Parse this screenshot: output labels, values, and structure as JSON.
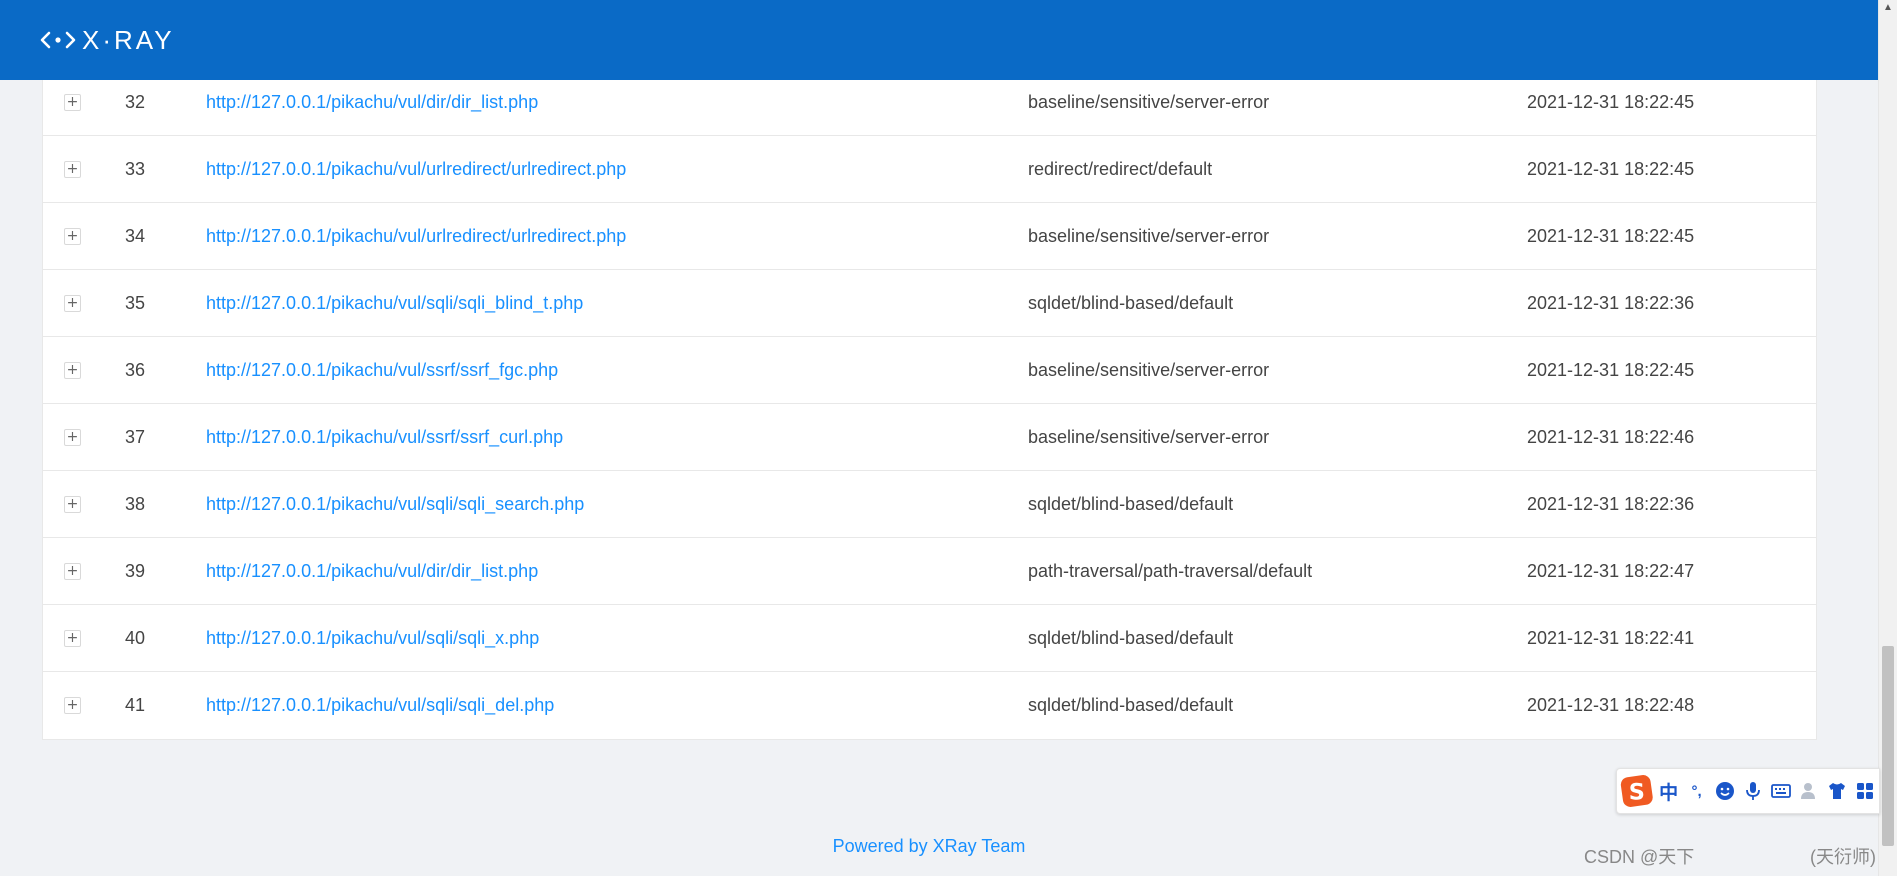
{
  "header": {
    "logo_text": "X·RAY",
    "brand_color": "#0a6ac6"
  },
  "rows": [
    {
      "id": "32",
      "url": "http://127.0.0.1/pikachu/vul/dir/dir_list.php",
      "plugin": "baseline/sensitive/server-error",
      "time": "2021-12-31 18:22:45"
    },
    {
      "id": "33",
      "url": "http://127.0.0.1/pikachu/vul/urlredirect/urlredirect.php",
      "plugin": "redirect/redirect/default",
      "time": "2021-12-31 18:22:45"
    },
    {
      "id": "34",
      "url": "http://127.0.0.1/pikachu/vul/urlredirect/urlredirect.php",
      "plugin": "baseline/sensitive/server-error",
      "time": "2021-12-31 18:22:45"
    },
    {
      "id": "35",
      "url": "http://127.0.0.1/pikachu/vul/sqli/sqli_blind_t.php",
      "plugin": "sqldet/blind-based/default",
      "time": "2021-12-31 18:22:36"
    },
    {
      "id": "36",
      "url": "http://127.0.0.1/pikachu/vul/ssrf/ssrf_fgc.php",
      "plugin": "baseline/sensitive/server-error",
      "time": "2021-12-31 18:22:45"
    },
    {
      "id": "37",
      "url": "http://127.0.0.1/pikachu/vul/ssrf/ssrf_curl.php",
      "plugin": "baseline/sensitive/server-error",
      "time": "2021-12-31 18:22:46"
    },
    {
      "id": "38",
      "url": "http://127.0.0.1/pikachu/vul/sqli/sqli_search.php",
      "plugin": "sqldet/blind-based/default",
      "time": "2021-12-31 18:22:36"
    },
    {
      "id": "39",
      "url": "http://127.0.0.1/pikachu/vul/dir/dir_list.php",
      "plugin": "path-traversal/path-traversal/default",
      "time": "2021-12-31 18:22:47"
    },
    {
      "id": "40",
      "url": "http://127.0.0.1/pikachu/vul/sqli/sqli_x.php",
      "plugin": "sqldet/blind-based/default",
      "time": "2021-12-31 18:22:41"
    },
    {
      "id": "41",
      "url": "http://127.0.0.1/pikachu/vul/sqli/sqli_del.php",
      "plugin": "sqldet/blind-based/default",
      "time": "2021-12-31 18:22:48"
    }
  ],
  "expand_symbol": "+",
  "footer": {
    "powered_by": "Powered by XRay Team"
  },
  "watermark": {
    "left": "CSDN @天下",
    "right": "(天衍师)"
  },
  "ime": {
    "logo_letter": "S",
    "mode_label": "中",
    "punct_label": "°,",
    "icons": [
      "emoji-icon",
      "microphone-icon",
      "keyboard-icon",
      "user-icon",
      "shirt-icon",
      "grid-icon"
    ]
  },
  "scrollbar": {
    "arrow": "▲"
  }
}
